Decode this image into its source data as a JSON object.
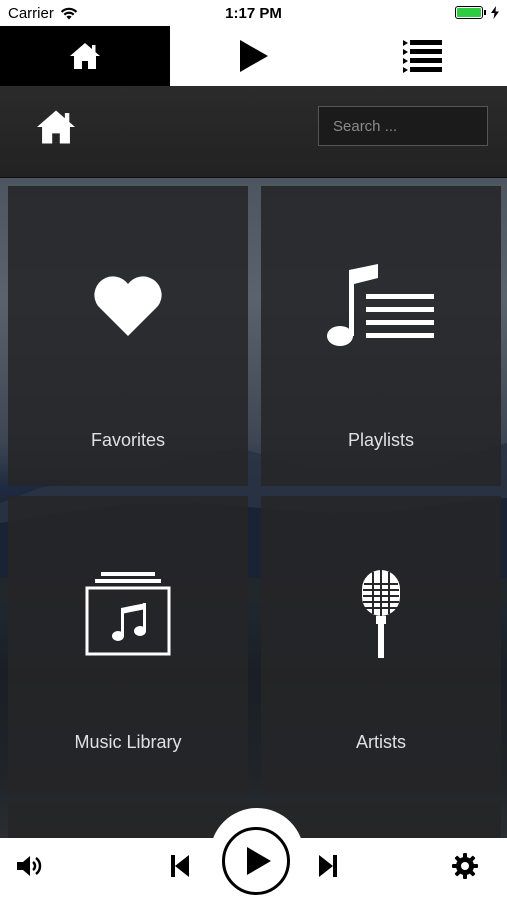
{
  "status_bar": {
    "carrier": "Carrier",
    "time": "1:17 PM"
  },
  "top_tabs": [
    {
      "name": "home",
      "icon": "home-icon"
    },
    {
      "name": "now-playing",
      "icon": "play-icon"
    },
    {
      "name": "queue",
      "icon": "list-icon"
    }
  ],
  "header": {
    "search_placeholder": "Search ..."
  },
  "tiles": [
    {
      "label": "Favorites",
      "icon": "heart-icon"
    },
    {
      "label": "Playlists",
      "icon": "playlist-icon"
    },
    {
      "label": "Music Library",
      "icon": "music-library-icon"
    },
    {
      "label": "Artists",
      "icon": "microphone-icon"
    }
  ],
  "player": {
    "icons": [
      "volume-icon",
      "previous-icon",
      "play-icon",
      "next-icon",
      "settings-icon"
    ]
  },
  "colors": {
    "battery": "#2ecc40",
    "tile_bg": "#262628",
    "accent": "#000000"
  }
}
